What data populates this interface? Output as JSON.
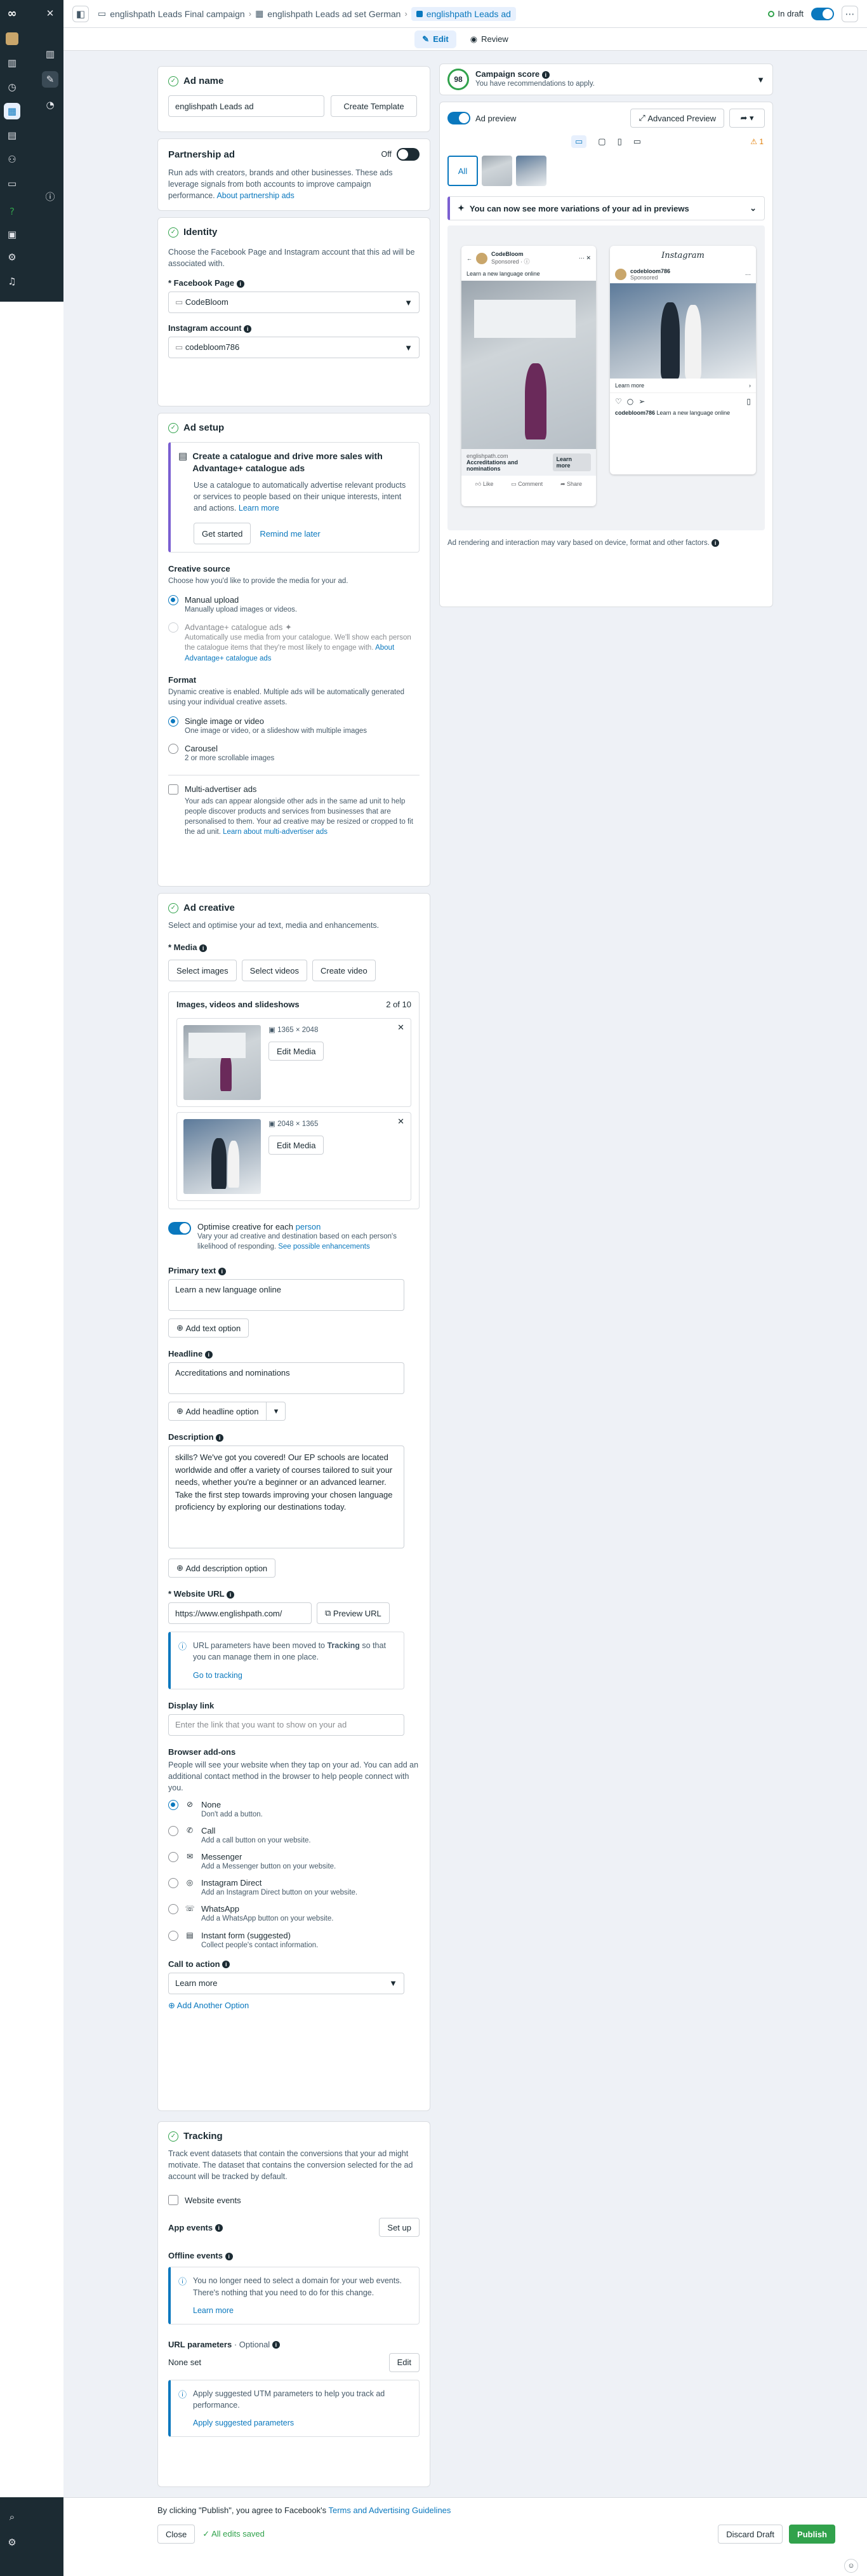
{
  "breadcrumb": {
    "campaign": "englishpath Leads Final campaign",
    "adset": "englishpath Leads ad set German",
    "ad": "englishpath Leads ad"
  },
  "status": {
    "label": "In draft"
  },
  "tabs": {
    "edit": "Edit",
    "review": "Review"
  },
  "ad_name": {
    "title": "Ad name",
    "value": "englishpath Leads ad",
    "create_template": "Create Template"
  },
  "partnership": {
    "title": "Partnership ad",
    "toggle_label": "Off",
    "desc": "Run ads with creators, brands and other businesses. These ads leverage signals from both accounts to improve campaign performance.",
    "link": "About partnership ads"
  },
  "identity": {
    "title": "Identity",
    "desc": "Choose the Facebook Page and Instagram account that this ad will be associated with.",
    "fb_label": "* Facebook Page",
    "fb_value": "CodeBloom",
    "ig_label": "Instagram account",
    "ig_value": "codebloom786"
  },
  "ad_setup": {
    "title": "Ad setup",
    "catalogue_title": "Create a catalogue and drive more sales with Advantage+ catalogue ads",
    "catalogue_desc": "Use a catalogue to automatically advertise relevant products or services to people based on their unique interests, intent and actions.",
    "learn_more": "Learn more",
    "get_started": "Get started",
    "remind": "Remind me later",
    "creative_source_label": "Creative source",
    "creative_source_desc": "Choose how you'd like to provide the media for your ad.",
    "manual_title": "Manual upload",
    "manual_desc": "Manually upload images or videos.",
    "adv_title": "Advantage+ catalogue ads",
    "adv_desc": "Automatically use media from your catalogue. We'll show each person the catalogue items that they're most likely to engage with.",
    "adv_link": "About Advantage+ catalogue ads",
    "format_label": "Format",
    "format_desc": "Dynamic creative is enabled. Multiple ads will be automatically generated using your individual creative assets.",
    "single_title": "Single image or video",
    "single_desc": "One image or video, or a slideshow with multiple images",
    "carousel_title": "Carousel",
    "carousel_desc": "2 or more scrollable images",
    "multi_title": "Multi-advertiser ads",
    "multi_desc": "Your ads can appear alongside other ads in the same ad unit to help people discover products and services from businesses that are personalised to them. Your ad creative may be resized or cropped to fit the ad unit.",
    "multi_link": "Learn about multi-advertiser ads"
  },
  "ad_creative": {
    "title": "Ad creative",
    "desc": "Select and optimise your ad text, media and enhancements.",
    "media_label": "* Media",
    "select_images": "Select images",
    "select_videos": "Select videos",
    "create_video": "Create video",
    "media_list_title": "Images, videos and slideshows",
    "media_count": "2 of 10",
    "media1_dims": "1365 × 2048",
    "media2_dims": "2048 × 1365",
    "edit_media": "Edit Media",
    "optimise_title": "Optimise creative for each",
    "optimise_title_link": "person",
    "optimise_desc": "Vary your ad creative and destination based on each person's likelihood of responding.",
    "optimise_link": "See possible enhancements",
    "primary_label": "Primary text",
    "primary_value": "Learn a new language online",
    "add_text": "Add text option",
    "headline_label": "Headline",
    "headline_value": "Accreditations and nominations",
    "add_headline": "Add headline option",
    "desc_label": "Description",
    "desc_value": "skills? We've got you covered! Our EP schools are located worldwide and offer a variety of courses tailored to suit your needs, whether you're a beginner or an advanced learner. Take the first step towards improving your chosen language proficiency by exploring our destinations today.",
    "add_desc": "Add description option",
    "url_label": "* Website URL",
    "url_value": "https://www.englishpath.com/",
    "preview_url": "Preview URL",
    "url_note_pre": "URL parameters have been moved to",
    "url_note_bold": "Tracking",
    "url_note_post": "so that you can manage them in one place.",
    "go_tracking": "Go to tracking",
    "display_label": "Display link",
    "display_placeholder": "Enter the link that you want to show on your ad",
    "browser_label": "Browser add-ons",
    "browser_desc": "People will see your website when they tap on your ad. You can add an additional contact method in the browser to help people connect with you.",
    "addons": [
      {
        "icon": "⊘",
        "title": "None",
        "desc": "Don't add a button."
      },
      {
        "icon": "✆",
        "title": "Call",
        "desc": "Add a call button on your website."
      },
      {
        "icon": "✉",
        "title": "Messenger",
        "desc": "Add a Messenger button on your website."
      },
      {
        "icon": "◎",
        "title": "Instagram Direct",
        "desc": "Add an Instagram Direct button on your website."
      },
      {
        "icon": "☏",
        "title": "WhatsApp",
        "desc": "Add a WhatsApp button on your website."
      },
      {
        "icon": "▤",
        "title": "Instant form (suggested)",
        "desc": "Collect people's contact information."
      }
    ],
    "cta_label": "Call to action",
    "cta_value": "Learn more",
    "add_option": "Add Another Option"
  },
  "tracking": {
    "title": "Tracking",
    "desc": "Track event datasets that contain the conversions that your ad might motivate. The dataset that contains the conversion selected for the ad account will be tracked by default.",
    "website_events": "Website events",
    "app_events": "App events",
    "set_up": "Set up",
    "offline_events": "Offline events",
    "offline_note": "You no longer need to select a domain for your web events. There's nothing that you need to do for this change.",
    "learn_more": "Learn more",
    "url_params": "URL parameters",
    "url_params_optional": "· Optional",
    "none_set": "None set",
    "edit": "Edit",
    "utm_note": "Apply suggested UTM parameters to help you track ad performance.",
    "utm_link": "Apply suggested parameters"
  },
  "preview": {
    "score_value": "98",
    "score_title": "Campaign score",
    "score_desc": "You have recommendations to apply.",
    "ad_preview": "Ad preview",
    "advanced_preview": "Advanced Preview",
    "warn_count": "1",
    "all": "All",
    "variations": "You can now see more variations of your ad in previews",
    "fb_page": "CodeBloom",
    "fb_sponsored": "Sponsored · ⓘ",
    "fb_text": "Learn a new language online",
    "fb_domain": "englishpath.com",
    "fb_headline": "Accreditations and nominations",
    "fb_cta": "Learn more",
    "fb_like": "Like",
    "fb_comment": "Comment",
    "fb_share": "Share",
    "ig_logo": "Instagram",
    "ig_account": "codebloom786",
    "ig_sponsored": "Sponsored",
    "ig_cta": "Learn more",
    "ig_caption_user": "codebloom786",
    "ig_caption": "Learn a new language online",
    "footer": "Ad rendering and interaction may vary based on device, format and other factors."
  },
  "bottom": {
    "terms_pre": "By clicking \"Publish\", you agree to Facebook's",
    "terms_link": "Terms and Advertising Guidelines",
    "close": "Close",
    "saved": "All edits saved",
    "discard": "Discard Draft",
    "publish": "Publish"
  }
}
